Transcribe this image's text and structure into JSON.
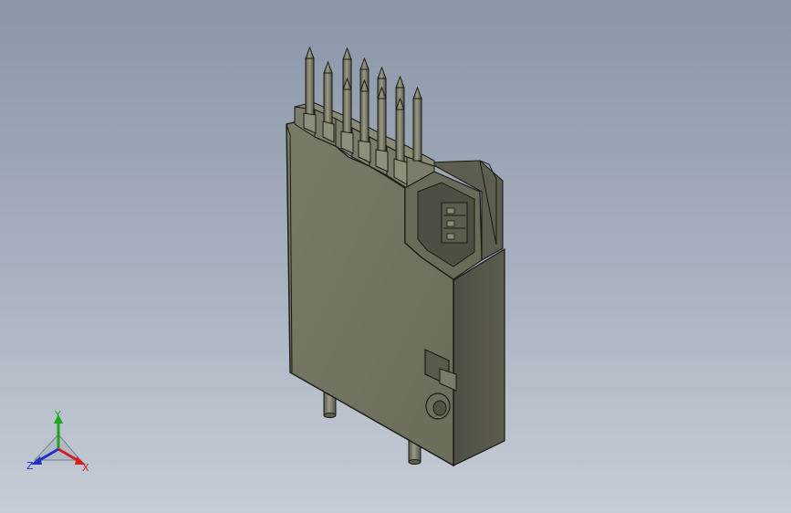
{
  "viewport": {
    "background_top": "#8a96a8",
    "background_bottom": "#c5ccd6"
  },
  "model": {
    "body_color": "#717160",
    "outline_color": "#1a1a16",
    "pin_count_visible": 12
  },
  "triad": {
    "x_label": "X",
    "y_label": "Y",
    "z_label": "Z",
    "x_color": "#d42020",
    "y_color": "#1aa51a",
    "z_color": "#2030c8"
  }
}
